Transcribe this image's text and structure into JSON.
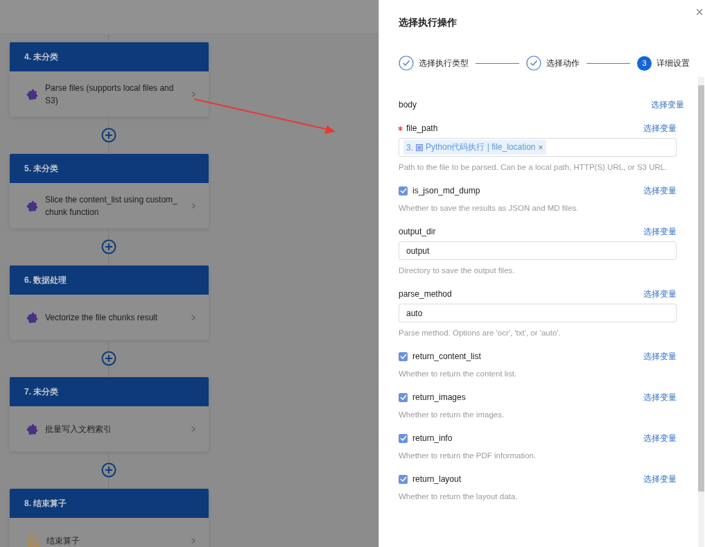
{
  "flow": {
    "nodes": [
      {
        "header": "4. 未分类",
        "kind": "plugin",
        "label": "Parse files (supports local files and S3)",
        "chevron": ">"
      },
      {
        "header": "5. 未分类",
        "kind": "plugin",
        "label": "Slice the content_list using custom_ chunk function",
        "chevron": ">"
      },
      {
        "header": "6. 数据处理",
        "kind": "plugin",
        "label": "Vectorize the file chunks result",
        "chevron": ">"
      },
      {
        "header": "7. 未分类",
        "kind": "plugin",
        "label": "批量写入文档索引",
        "chevron": ">"
      },
      {
        "header": "8. 结束算子",
        "kind": "end",
        "label": "结束算子",
        "chevron": ">"
      }
    ]
  },
  "drawer": {
    "title": "选择执行操作",
    "close": "×",
    "steps": [
      {
        "label": "选择执行类型",
        "done": true
      },
      {
        "label": "选择动作",
        "done": true
      },
      {
        "number": "3",
        "label": "详细设置",
        "done": false
      }
    ],
    "fields": [
      {
        "kind": "heading",
        "label": "body",
        "link": "选择变量"
      },
      {
        "kind": "tags",
        "label": "file_path",
        "required": true,
        "link": "选择变量",
        "tag": {
          "index": "3.",
          "text": "Python代码执行 | file_location",
          "remove": "×"
        },
        "description": "Path to the file to be parsed. Can be a local path, HTTP(S) URL, or S3 URL."
      },
      {
        "kind": "checkbox",
        "label": "is_json_md_dump",
        "checked": true,
        "link": "选择变量",
        "description": "Whether to save the results as JSON and MD files."
      },
      {
        "kind": "text",
        "label": "output_dir",
        "link": "选择变量",
        "value": "output",
        "description": "Directory to save the output files."
      },
      {
        "kind": "text",
        "label": "parse_method",
        "link": "选择变量",
        "value": "auto",
        "description": "Parse method. Options are 'ocr', 'txt', or 'auto'."
      },
      {
        "kind": "checkbox",
        "label": "return_content_list",
        "checked": true,
        "link": "选择变量",
        "description": "Whether to return the content list."
      },
      {
        "kind": "checkbox",
        "label": "return_images",
        "checked": true,
        "link": "选择变量",
        "description": "Whether to return the images."
      },
      {
        "kind": "checkbox",
        "label": "return_info",
        "checked": true,
        "link": "选择变量",
        "description": "Whether to return the PDF information."
      },
      {
        "kind": "checkbox",
        "label": "return_layout",
        "checked": true,
        "link": "选择变量",
        "description": "Whether to return the layout data."
      }
    ]
  }
}
